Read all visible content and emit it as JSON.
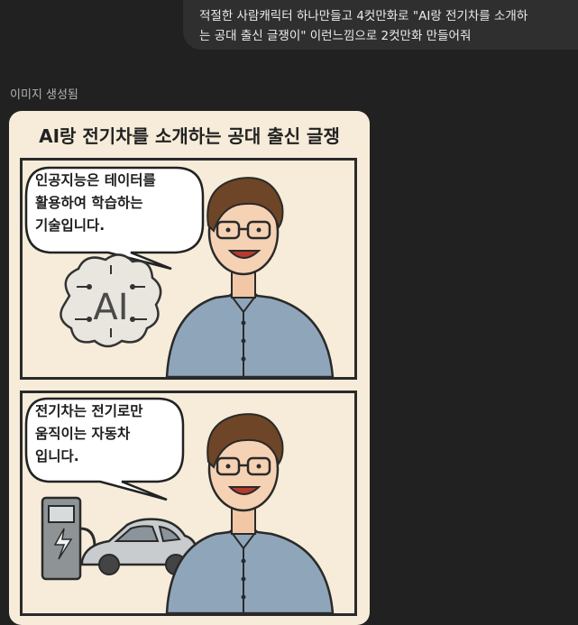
{
  "user_message": {
    "line1": "적절한 사람캐릭터 하나만들고 4컷만화로 \"AI랑 전기차를 소개하",
    "line2": "는 공대 출신 글쟁이\" 이런느낌으로 2컷만화 만들어줘"
  },
  "status": {
    "label": "이미지 생성됨"
  },
  "comic": {
    "title": "AI랑 전기차를 소개하는 공대 출신 글쟁",
    "panels": [
      {
        "speech_lines": [
          "인공지능은 테이터를",
          "활용하여 학습하는",
          "기술입니다."
        ],
        "prop_text": "AI"
      },
      {
        "speech_lines": [
          "전기차는 전기로만",
          "움직이는 자동차",
          "입니다."
        ]
      }
    ]
  },
  "colors": {
    "background": "#212121",
    "user_bubble": "#2f2f2f",
    "comic_paper": "#f6ecd9",
    "shirt": "#8fa6ba",
    "hair": "#6e4526"
  },
  "icons": [
    "brain-icon",
    "charging-station-icon",
    "lightning-bolt-icon",
    "electric-car-icon"
  ]
}
